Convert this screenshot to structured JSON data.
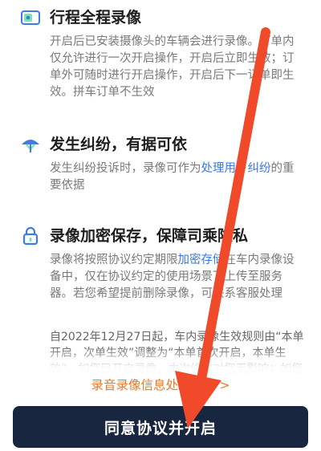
{
  "sections": [
    {
      "icon": "camera-card-icon",
      "title": "行程全程录像",
      "body": "开启后已安装摄像头的车辆会进行录像。订单内仅允许进行一次开启操作，开启后立即生效；订单外可随时进行开启操作，开启后下一订单即生效。拼车订单不生效"
    },
    {
      "icon": "umbrella-shield-icon",
      "title": "发生纠纷，有据可依",
      "body_pre": "发生纠纷投诉时，录像可作为",
      "body_link": "处理用户纠纷",
      "body_post": "的重要依据"
    },
    {
      "icon": "lock-icon",
      "title": "录像加密保存，保障司乘隐私",
      "body_pre": "录像将按照协议约定期限",
      "body_link": "加密存储",
      "body_post": "在车内录像设备中，仅在协议约定的使用场景下上传至服务器。若您希望提前删除录像，可联系客服处理"
    }
  ],
  "notice": "自2022年12月27日起，车内录像生效规则由“本单开启，次单生效”调整为“本单首次开启，本单生效”。如您已开启录像，本次修改对您无影响；如您关闭录",
  "agreement_link": "录音录像信息处理协议 >",
  "cta_label": "同意协议并开启",
  "colors": {
    "link": "#3a78e6",
    "agreement": "#e8792b",
    "cta_bg": "#18263f",
    "annotation_arrow": "#f04a2a"
  }
}
